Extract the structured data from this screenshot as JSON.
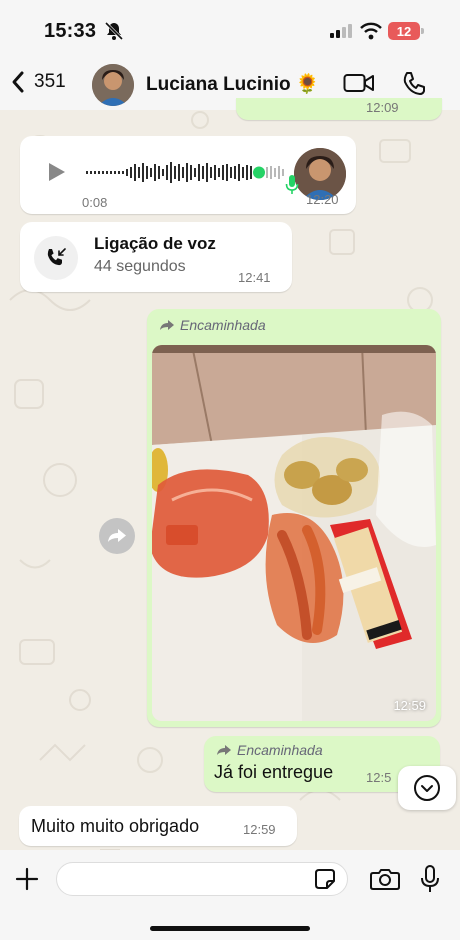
{
  "status_bar": {
    "time": "15:33",
    "battery": "12",
    "icons": [
      "bell-off-icon",
      "signal-icon",
      "wifi-icon",
      "battery-icon"
    ]
  },
  "header": {
    "back_count": "351",
    "contact_name": "Luciana Lucinio 🌻",
    "icons": [
      "chevron-left-icon",
      "video-call-icon",
      "phone-icon"
    ]
  },
  "messages": {
    "top_partial_time": "12:09",
    "voice_note": {
      "duration": "0:08",
      "time": "12:20",
      "icons": [
        "play-icon",
        "mic-icon"
      ]
    },
    "voice_call": {
      "title": "Ligação de voz",
      "subtitle": "44 segundos",
      "time": "12:41",
      "icon": "incoming-call-icon"
    },
    "photo_message": {
      "forwarded_label": "Encaminhada",
      "time": "12:59",
      "icon": "forward-arrow-icon"
    },
    "text_out": {
      "forwarded_label": "Encaminhada",
      "text": "Já foi entregue",
      "time": "12:5"
    },
    "text_in": {
      "text": "Muito muito obrigado",
      "time": "12:59"
    }
  },
  "composer": {
    "placeholder": "",
    "icons": [
      "plus-icon",
      "sticker-icon",
      "camera-icon",
      "mic-icon"
    ]
  },
  "colors": {
    "outgoing_bubble": "#dcf8c6",
    "incoming_bubble": "#ffffff",
    "accent_green": "#25d366",
    "battery_red": "#e85a5a"
  }
}
